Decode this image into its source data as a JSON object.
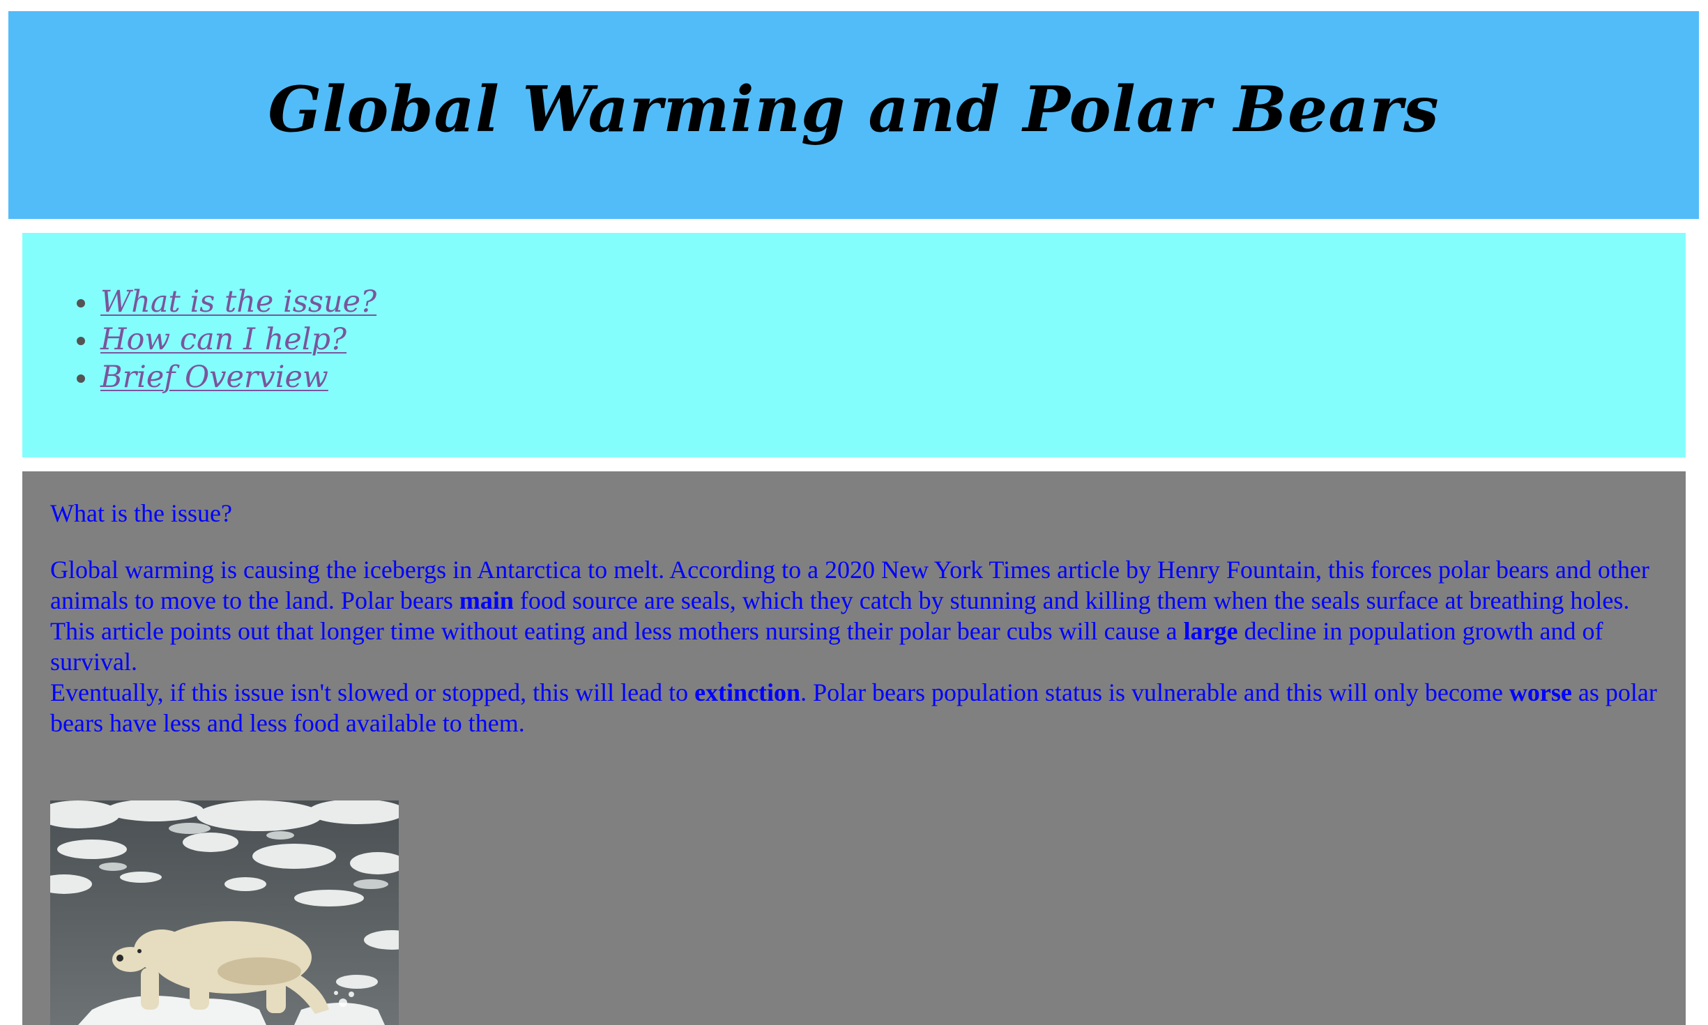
{
  "header": {
    "title": "Global Warming and Polar Bears"
  },
  "nav": {
    "items": [
      {
        "label": "What is the issue?"
      },
      {
        "label": "How can I help?"
      },
      {
        "label": "Brief Overview"
      }
    ]
  },
  "main": {
    "section_title": "What is the issue?",
    "p1": "Global warming is causing the icebergs in Antarctica to melt. According to a 2020 New York Times article by Henry Fountain, this forces polar bears and other animals to move to the land. Polar bears ",
    "p1_bold": "main",
    "p1_end": " food source are seals, which they catch by stunning and killing them when the seals surface at breathing holes.",
    "p2": "This article points out that longer time without eating and less mothers nursing their polar bear cubs will cause a ",
    "p2_bold": "large",
    "p2_end": " decline in population growth and of  survival.",
    "p3": "Eventually, if  this issue isn't slowed or stopped, this will lead to ",
    "p3_bold": "extinction",
    "p3_mid": ". Polar bears population status is vulnerable and this will only become ",
    "p3_bold2": "worse",
    "p3_end": " as polar bears have less and less food available to them."
  },
  "colors": {
    "header_bg": "#52bcf9",
    "nav_bg": "#84fefd",
    "content_bg": "#808080",
    "content_text": "#0000ff",
    "nav_link": "#7b559b"
  }
}
